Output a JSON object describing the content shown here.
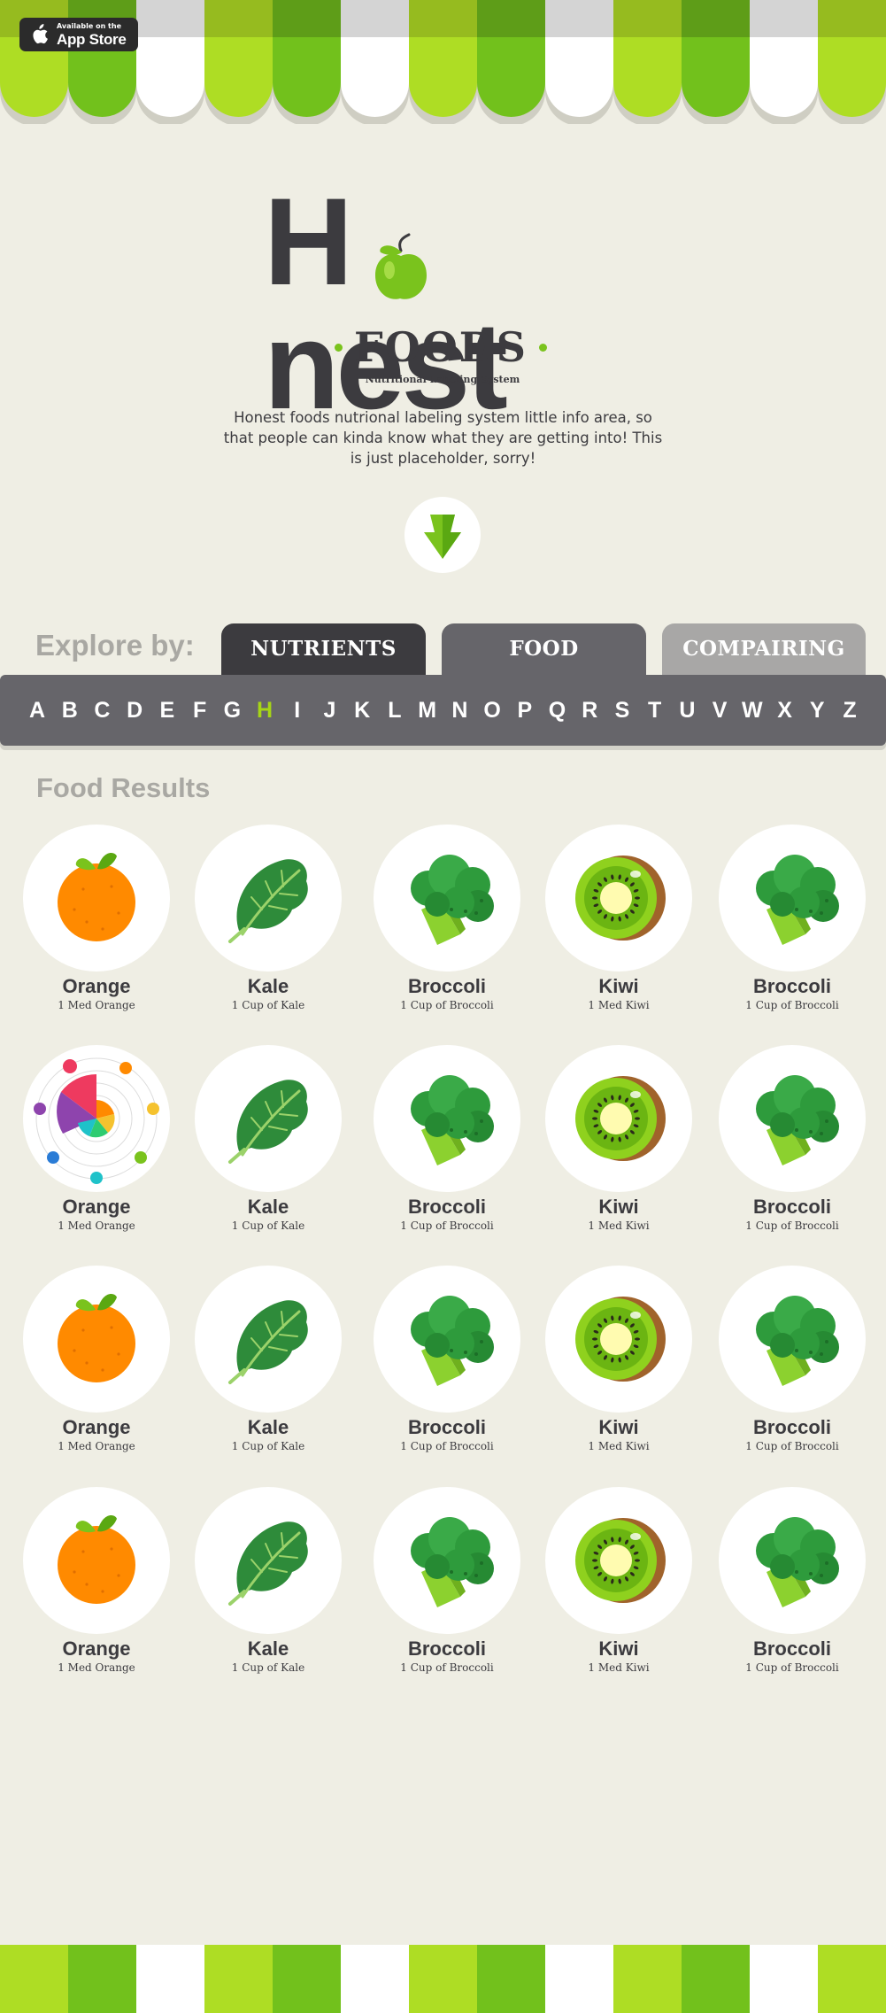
{
  "app_store": {
    "small": "Available on the",
    "big": "App Store"
  },
  "logo": {
    "word_left": "H",
    "word_right": "nest",
    "foods": "FOODS",
    "tagline": "Nutritional Labeling System"
  },
  "intro": "Honest foods nutrional labeling system little info area, so that people can kinda know what they are getting into! This is just placeholder, sorry!",
  "explore": {
    "label": "Explore by:",
    "tabs": [
      "NUTRIENTS",
      "FOOD",
      "COMPAIRING"
    ]
  },
  "alphabet": [
    "A",
    "B",
    "C",
    "D",
    "E",
    "F",
    "G",
    "H",
    "I",
    "J",
    "K",
    "L",
    "M",
    "N",
    "O",
    "P",
    "Q",
    "R",
    "S",
    "T",
    "U",
    "V",
    "W",
    "X",
    "Y",
    "Z"
  ],
  "alphabet_active": "H",
  "results": {
    "title": "Food Results",
    "rows": [
      [
        {
          "name": "Orange",
          "serving": "1 Med Orange",
          "icon": "orange-icon"
        },
        {
          "name": "Kale",
          "serving": "1 Cup of Kale",
          "icon": "kale-icon"
        },
        {
          "name": "Broccoli",
          "serving": "1 Cup of Broccoli",
          "icon": "broccoli-icon"
        },
        {
          "name": "Kiwi",
          "serving": "1 Med Kiwi",
          "icon": "kiwi-icon"
        },
        {
          "name": "Broccoli",
          "serving": "1 Cup of Broccoli",
          "icon": "broccoli-icon"
        }
      ],
      [
        {
          "name": "Orange",
          "serving": "1 Med Orange",
          "icon": "nutrient-chart-icon"
        },
        {
          "name": "Kale",
          "serving": "1 Cup of Kale",
          "icon": "kale-icon"
        },
        {
          "name": "Broccoli",
          "serving": "1 Cup of Broccoli",
          "icon": "broccoli-icon"
        },
        {
          "name": "Kiwi",
          "serving": "1 Med Kiwi",
          "icon": "kiwi-icon"
        },
        {
          "name": "Broccoli",
          "serving": "1 Cup of Broccoli",
          "icon": "broccoli-icon"
        }
      ],
      [
        {
          "name": "Orange",
          "serving": "1 Med Orange",
          "icon": "orange-icon"
        },
        {
          "name": "Kale",
          "serving": "1 Cup of Kale",
          "icon": "kale-icon"
        },
        {
          "name": "Broccoli",
          "serving": "1 Cup of Broccoli",
          "icon": "broccoli-icon"
        },
        {
          "name": "Kiwi",
          "serving": "1 Med Kiwi",
          "icon": "kiwi-icon"
        },
        {
          "name": "Broccoli",
          "serving": "1 Cup of Broccoli",
          "icon": "broccoli-icon"
        }
      ],
      [
        {
          "name": "Orange",
          "serving": "1 Med Orange",
          "icon": "orange-icon"
        },
        {
          "name": "Kale",
          "serving": "1 Cup of Kale",
          "icon": "kale-icon"
        },
        {
          "name": "Broccoli",
          "serving": "1 Cup of Broccoli",
          "icon": "broccoli-icon"
        },
        {
          "name": "Kiwi",
          "serving": "1 Med Kiwi",
          "icon": "kiwi-icon"
        },
        {
          "name": "Broccoli",
          "serving": "1 Cup of Broccoli",
          "icon": "broccoli-icon"
        }
      ]
    ]
  },
  "colors": {
    "accent_green": "#7ac31d",
    "stripe_colors": [
      "#aedd24",
      "#72c11c",
      "#ffffff"
    ],
    "dark": "#3c3b3f",
    "background": "#efeee4"
  }
}
